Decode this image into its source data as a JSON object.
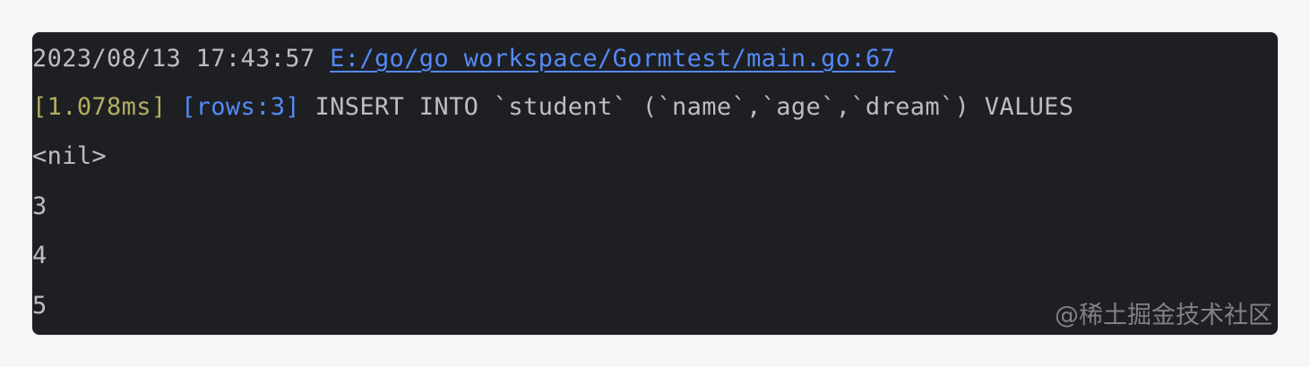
{
  "console": {
    "log_header": {
      "timestamp": "2023/08/13 17:43:57",
      "file_link": "E:/go/go_workspace/Gormtest/main.go:67"
    },
    "sql_line": {
      "duration": "[1.078ms]",
      "rows": "[rows:3]",
      "statement": "INSERT INTO `student` (`name`,`age`,`dream`) VALUES"
    },
    "output_lines": [
      "<nil>",
      "3",
      "4",
      "5"
    ]
  },
  "watermark": "@稀土掘金技术社区",
  "colors": {
    "background": "#1e1f22",
    "text": "#bcbec4",
    "link": "#548af7",
    "duration": "#b3ae60"
  }
}
